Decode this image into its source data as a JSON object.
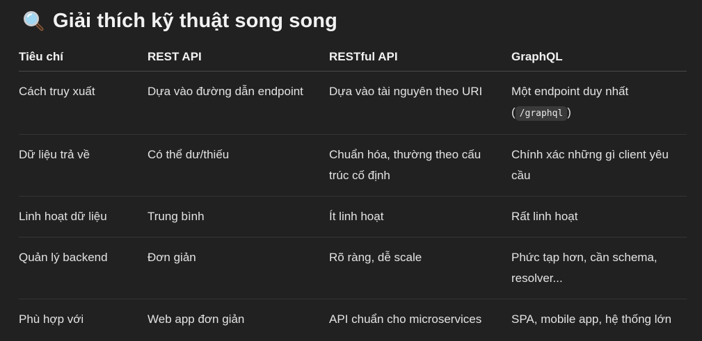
{
  "heading": {
    "icon": "magnifying-glass-icon",
    "title": "Giải thích kỹ thuật song song"
  },
  "table": {
    "headers": [
      "Tiêu chí",
      "REST API",
      "RESTful API",
      "GraphQL"
    ],
    "rows": [
      {
        "criterion": "Cách truy xuất",
        "rest": "Dựa vào đường dẫn endpoint",
        "restful": "Dựa vào tài nguyên theo URI",
        "graphql_prefix": "Một endpoint duy nhất (",
        "graphql_code": "/graphql",
        "graphql_suffix": ")"
      },
      {
        "criterion": "Dữ liệu trả về",
        "rest": "Có thể dư/thiếu",
        "restful": "Chuẩn hóa, thường theo cấu trúc cố định",
        "graphql": "Chính xác những gì client yêu cầu"
      },
      {
        "criterion": "Linh hoạt dữ liệu",
        "rest": "Trung bình",
        "restful": "Ít linh hoạt",
        "graphql": "Rất linh hoạt"
      },
      {
        "criterion": "Quản lý backend",
        "rest": "Đơn giản",
        "restful": "Rõ ràng, dễ scale",
        "graphql": "Phức tạp hơn, cần schema, resolver..."
      },
      {
        "criterion": "Phù hợp với",
        "rest": "Web app đơn giản",
        "restful": "API chuẩn cho microservices",
        "graphql": "SPA, mobile app, hệ thống lớn"
      }
    ]
  }
}
